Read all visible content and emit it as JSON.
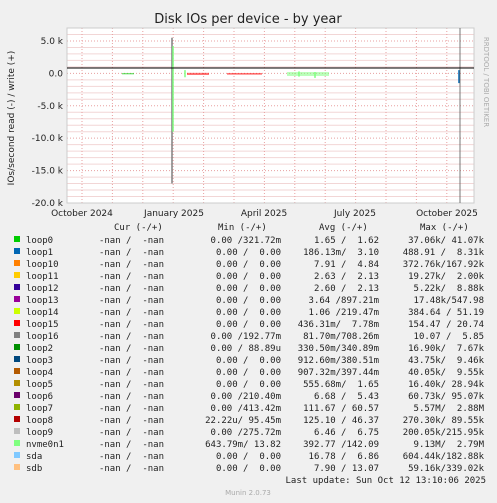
{
  "chart_data": {
    "type": "line",
    "title": "Disk IOs per device - by year",
    "ylabel": "IOs/second read (-) / write (+)",
    "ylim": [
      -20000,
      7000
    ],
    "y_ticks": [
      "5.0 k",
      "0.0",
      "-5.0 k",
      "-10.0 k",
      "-15.0 k",
      "-20.0 k"
    ],
    "y_tick_values": [
      5000,
      0,
      -5000,
      -10000,
      -15000,
      -20000
    ],
    "x_ticks": [
      "October 2024",
      "January 2025",
      "April 2025",
      "July 2025",
      "October 2025"
    ],
    "x_tick_days": [
      15,
      107,
      197,
      288,
      380
    ],
    "x_range_days": [
      0,
      407
    ],
    "grid": true,
    "side_label": "RRDTOOL / TOBI OETIKER",
    "spikes": [
      {
        "series": "loop16",
        "day": 105,
        "read": -17000,
        "write": 5500
      },
      {
        "series": "nvme0n1",
        "day": 106,
        "read": -9000,
        "write": 4200
      },
      {
        "series": "nvme0n1",
        "day": 118,
        "read": -600,
        "write": 500
      },
      {
        "series": "nvme0n1",
        "day": 232,
        "read": -500,
        "write": 300
      },
      {
        "series": "nvme0n1",
        "day": 248,
        "read": -700,
        "write": 200
      },
      {
        "series": "loop1",
        "day": 392,
        "read": -1500,
        "write": 500
      }
    ],
    "bands": [
      {
        "series": "loop0",
        "start_day": 55,
        "end_day": 67,
        "read": -150,
        "write": 60
      },
      {
        "series": "loop15",
        "start_day": 120,
        "end_day": 142,
        "read": -250,
        "write": 80
      },
      {
        "series": "loop15",
        "start_day": 160,
        "end_day": 195,
        "read": -200,
        "write": 60
      },
      {
        "series": "nvme0n1",
        "start_day": 220,
        "end_day": 262,
        "read": -400,
        "write": 200
      }
    ],
    "columns": [
      "Cur (-/+)",
      "Min (-/+)",
      "Avg (-/+)",
      "Max (-/+)"
    ],
    "series": [
      {
        "name": "loop0",
        "color": "#00cc00",
        "cur": "-nan /  -nan",
        "min": "0.00 /321.72m",
        "avg": "1.65 /  1.62",
        "max": "37.06k/ 41.07k"
      },
      {
        "name": "loop1",
        "color": "#0066b3",
        "cur": "-nan /  -nan",
        "min": "0.00 /  0.00",
        "avg": "186.13m/  3.10",
        "max": "488.91 /  8.31k"
      },
      {
        "name": "loop10",
        "color": "#ff8000",
        "cur": "-nan /  -nan",
        "min": "0.00 /  0.00",
        "avg": "7.91 /  4.84",
        "max": "372.76k/167.92k"
      },
      {
        "name": "loop11",
        "color": "#ffcc00",
        "cur": "-nan /  -nan",
        "min": "0.00 /  0.00",
        "avg": "2.63 /  2.13",
        "max": "19.27k/  2.00k"
      },
      {
        "name": "loop12",
        "color": "#330099",
        "cur": "-nan /  -nan",
        "min": "0.00 /  0.00",
        "avg": "2.60 /  2.13",
        "max": "5.22k/  8.88k"
      },
      {
        "name": "loop13",
        "color": "#990099",
        "cur": "-nan /  -nan",
        "min": "0.00 /  0.00",
        "avg": "3.64 /897.21m",
        "max": "17.48k/547.98"
      },
      {
        "name": "loop14",
        "color": "#ccff00",
        "cur": "-nan /  -nan",
        "min": "0.00 /  0.00",
        "avg": "1.06 /219.47m",
        "max": "384.64 / 51.19"
      },
      {
        "name": "loop15",
        "color": "#ff0000",
        "cur": "-nan /  -nan",
        "min": "0.00 /  0.00",
        "avg": "436.31m/  7.78m",
        "max": "154.47 / 20.74"
      },
      {
        "name": "loop16",
        "color": "#808080",
        "cur": "-nan /  -nan",
        "min": "0.00 /192.77m",
        "avg": "81.70m/708.26m",
        "max": "10.07 /  5.85"
      },
      {
        "name": "loop2",
        "color": "#008f00",
        "cur": "-nan /  -nan",
        "min": "0.00 / 88.89u",
        "avg": "330.50m/340.89m",
        "max": "16.90k/  7.67k"
      },
      {
        "name": "loop3",
        "color": "#00487d",
        "cur": "-nan /  -nan",
        "min": "0.00 /  0.00",
        "avg": "912.60m/380.51m",
        "max": "43.75k/  9.46k"
      },
      {
        "name": "loop4",
        "color": "#b35a00",
        "cur": "-nan /  -nan",
        "min": "0.00 /  0.00",
        "avg": "907.32m/397.44m",
        "max": "40.05k/  9.55k"
      },
      {
        "name": "loop5",
        "color": "#b38f00",
        "cur": "-nan /  -nan",
        "min": "0.00 /  0.00",
        "avg": "555.68m/  1.65",
        "max": "16.40k/ 28.94k"
      },
      {
        "name": "loop6",
        "color": "#6b006b",
        "cur": "-nan /  -nan",
        "min": "0.00 /210.40m",
        "avg": "6.68 /  5.43",
        "max": "60.73k/ 95.07k"
      },
      {
        "name": "loop7",
        "color": "#8fb300",
        "cur": "-nan /  -nan",
        "min": "0.00 /413.42m",
        "avg": "111.67 / 60.57",
        "max": "5.57M/  2.88M"
      },
      {
        "name": "loop8",
        "color": "#b30000",
        "cur": "-nan /  -nan",
        "min": "22.22u/ 95.45m",
        "avg": "125.10 / 46.37",
        "max": "270.30k/ 89.55k"
      },
      {
        "name": "loop9",
        "color": "#bebebe",
        "cur": "-nan /  -nan",
        "min": "0.00 /275.72m",
        "avg": "6.46 /  6.75",
        "max": "200.05k/215.95k"
      },
      {
        "name": "nvme0n1",
        "color": "#80ff80",
        "cur": "-nan /  -nan",
        "min": "643.79m/ 13.82",
        "avg": "392.77 /142.09",
        "max": "9.13M/  2.79M"
      },
      {
        "name": "sda",
        "color": "#80c9ff",
        "cur": "-nan /  -nan",
        "min": "0.00 /  0.00",
        "avg": "16.78 /  6.86",
        "max": "604.44k/182.88k"
      },
      {
        "name": "sdb",
        "color": "#ffc080",
        "cur": "-nan /  -nan",
        "min": "0.00 /  0.00",
        "avg": "7.90 / 13.07",
        "max": "59.16k/339.02k"
      }
    ],
    "last_update": "Last update: Sun Oct 12 13:10:06 2025",
    "footer": "Munin 2.0.73"
  }
}
